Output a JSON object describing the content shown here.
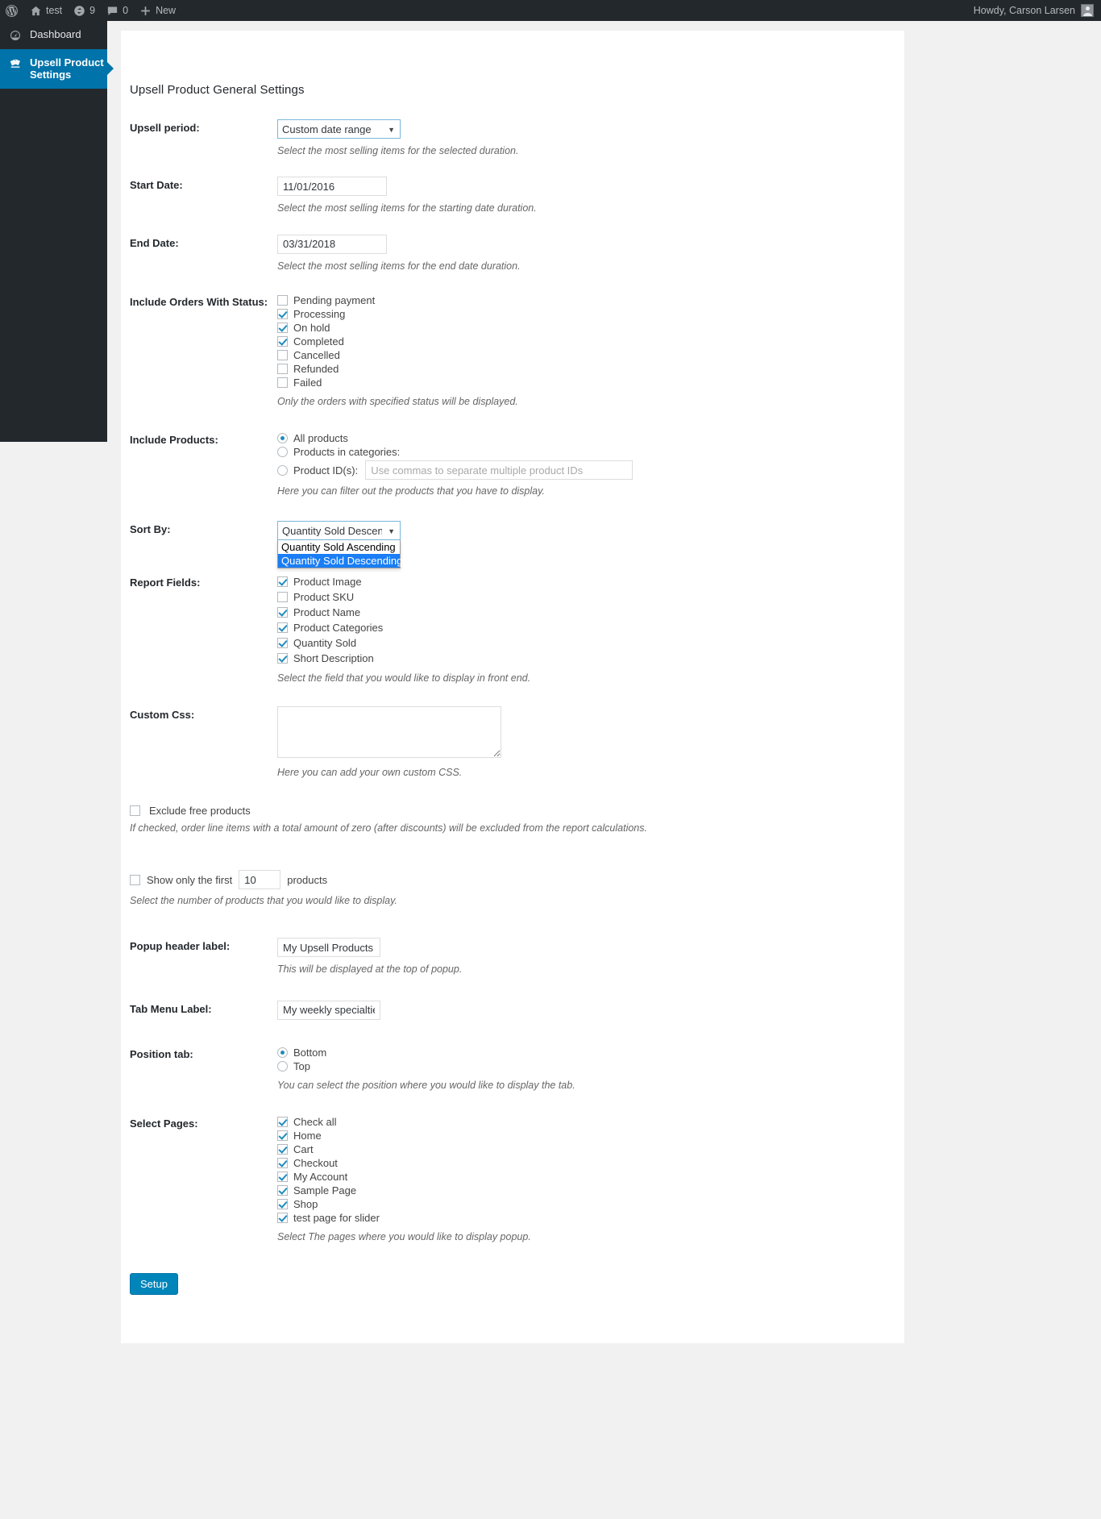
{
  "adminbar": {
    "wp_logo": "wordpress-logo-icon",
    "site_name": "test",
    "updates_icon": "updates-icon",
    "updates_count": "9",
    "comments_icon": "comments-icon",
    "comments_count": "0",
    "new_icon": "plus-icon",
    "new_label": "New",
    "howdy": "Howdy, Carson Larsen",
    "avatar": "user-avatar"
  },
  "sidebar": {
    "items": [
      {
        "label": "Dashboard",
        "icon": "dashboard-icon",
        "current": false
      },
      {
        "label": "Upsell Product Settings",
        "icon": "upsell-product-icon",
        "current": true
      }
    ]
  },
  "page": {
    "title": "Upsell Product General Settings"
  },
  "form": {
    "upsell_period": {
      "label": "Upsell period:",
      "value": "Custom date range",
      "options": [
        "Custom date range"
      ],
      "desc": "Select the most selling items for the selected duration."
    },
    "start_date": {
      "label": "Start Date:",
      "value": "11/01/2016",
      "desc": "Select the most selling items for the starting date duration."
    },
    "end_date": {
      "label": "End Date:",
      "value": "03/31/2018",
      "desc": "Select the most selling items for the end date duration."
    },
    "order_status": {
      "label": "Include Orders With Status:",
      "desc": "Only the orders with specified status will be displayed.",
      "items": [
        {
          "label": "Pending payment",
          "checked": false
        },
        {
          "label": "Processing",
          "checked": true
        },
        {
          "label": "On hold",
          "checked": true
        },
        {
          "label": "Completed",
          "checked": true
        },
        {
          "label": "Cancelled",
          "checked": false
        },
        {
          "label": "Refunded",
          "checked": false
        },
        {
          "label": "Failed",
          "checked": false
        }
      ]
    },
    "include_products": {
      "label": "Include Products:",
      "desc": "Here you can filter out the products that you have to display.",
      "options": [
        {
          "label": "All products",
          "checked": true
        },
        {
          "label": "Products in categories:",
          "checked": false
        },
        {
          "label": "Product ID(s):",
          "checked": false
        }
      ],
      "product_ids_placeholder": "Use commas to separate multiple product IDs",
      "product_ids_value": ""
    },
    "sort_by": {
      "label": "Sort By:",
      "value": "Quantity Sold Descending",
      "open": true,
      "options": [
        {
          "label": "Quantity Sold Ascending",
          "selected": false
        },
        {
          "label": "Quantity Sold Descending",
          "selected": true
        }
      ]
    },
    "report_fields": {
      "label": "Report Fields:",
      "desc": "Select the field that you would like to display in front end.",
      "items": [
        {
          "label": "Product Image",
          "checked": true
        },
        {
          "label": "Product SKU",
          "checked": false
        },
        {
          "label": "Product Name",
          "checked": true
        },
        {
          "label": "Product Categories",
          "checked": true
        },
        {
          "label": "Quantity Sold",
          "checked": true
        },
        {
          "label": "Short Description",
          "checked": true
        }
      ]
    },
    "custom_css": {
      "label": "Custom Css:",
      "value": "",
      "desc": "Here you can add your own custom CSS."
    },
    "exclude_free": {
      "label": "Exclude free products",
      "checked": false,
      "desc": "If checked, order line items with a total amount of zero (after discounts) will be excluded from the report calculations."
    },
    "show_only_first": {
      "label_before": "Show only the first",
      "value": "10",
      "label_after": "products",
      "checked": false,
      "desc": "Select the number of products that you would like to display."
    },
    "popup_header_label": {
      "label": "Popup header label:",
      "value": "My Upsell Products",
      "desc": "This will be displayed at the top of popup."
    },
    "tab_menu_label": {
      "label": "Tab Menu Label:",
      "value": "My weekly specialties"
    },
    "position_tab": {
      "label": "Position tab:",
      "desc": "You can select the position where you would like to display the tab.",
      "options": [
        {
          "label": "Bottom",
          "checked": true
        },
        {
          "label": "Top",
          "checked": false
        }
      ]
    },
    "select_pages": {
      "label": "Select Pages:",
      "desc": "Select The pages where you would like to display popup.",
      "items": [
        {
          "label": "Check all",
          "checked": true
        },
        {
          "label": "Home",
          "checked": true
        },
        {
          "label": "Cart",
          "checked": true
        },
        {
          "label": "Checkout",
          "checked": true
        },
        {
          "label": "My Account",
          "checked": true
        },
        {
          "label": "Sample Page",
          "checked": true
        },
        {
          "label": "Shop",
          "checked": true
        },
        {
          "label": "test page for slider",
          "checked": true
        }
      ]
    },
    "submit": {
      "label": "Setup"
    }
  },
  "colors": {
    "admin_dark": "#23282d",
    "accent_blue": "#0073aa",
    "button_blue": "#0085ba",
    "check_blue": "#1e8cbe",
    "highlight_blue": "#1a7ef5"
  }
}
